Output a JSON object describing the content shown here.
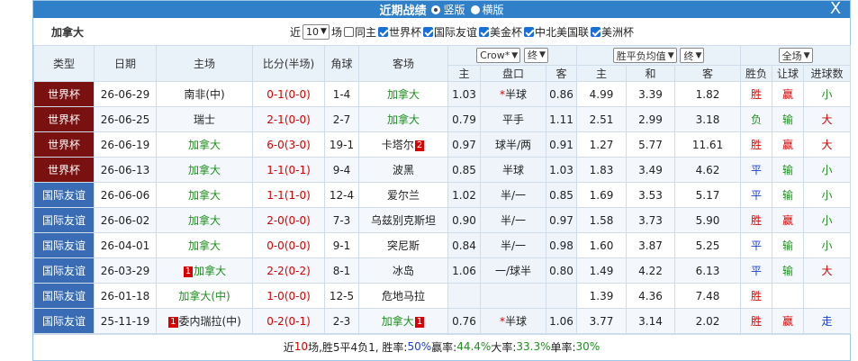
{
  "title": {
    "text": "近期战绩",
    "opt_vertical": "竖版",
    "opt_horizontal": "横版",
    "close": "X"
  },
  "filter": {
    "team": "加拿大",
    "prefix": "近",
    "count": "10",
    "suffix": "场",
    "same_host": "同主",
    "c1": "世界杯",
    "c2": "国际友谊",
    "c3": "美金杯",
    "c4": "中北美国联",
    "c5": "美洲杯"
  },
  "headers": {
    "type": "类型",
    "date": "日期",
    "home": "主场",
    "score": "比分(半场)",
    "corner": "角球",
    "away": "客场",
    "book": "Crow*",
    "book_end": "终",
    "home_o": "主",
    "handicap": "盘口",
    "away_o": "客",
    "avg": "胜平负均值",
    "avg_end": "终",
    "h": "主",
    "d": "和",
    "a": "客",
    "wl": "胜负",
    "hc": "让球",
    "goals": "进球数",
    "all": "全场"
  },
  "rows": [
    {
      "type": "世界杯",
      "kind": "wc",
      "date": "26-06-29",
      "home": "南非(中)",
      "home_green": false,
      "home_badge": "",
      "score": "0-1(0-0)",
      "corner": "1-4",
      "away": "加拿大",
      "away_green": true,
      "away_badge": "",
      "o1": "1.03",
      "hcap": "*半球",
      "o2": "0.86",
      "h": "4.99",
      "d": "3.39",
      "a": "1.82",
      "wl": "胜",
      "wl_c": "red",
      "hc": "赢",
      "hc_c": "red",
      "g": "小",
      "g_c": "green"
    },
    {
      "type": "世界杯",
      "kind": "wc",
      "date": "26-06-25",
      "home": "瑞士",
      "home_green": false,
      "home_badge": "",
      "score": "2-1(0-0)",
      "corner": "2-7",
      "away": "加拿大",
      "away_green": true,
      "away_badge": "",
      "o1": "0.79",
      "hcap": "平手",
      "o2": "1.11",
      "h": "2.51",
      "d": "2.99",
      "a": "3.18",
      "wl": "负",
      "wl_c": "green",
      "hc": "输",
      "hc_c": "green",
      "g": "大",
      "g_c": "red"
    },
    {
      "type": "世界杯",
      "kind": "wc",
      "date": "26-06-19",
      "home": "加拿大",
      "home_green": true,
      "home_badge": "",
      "score": "6-0(3-0)",
      "corner": "19-1",
      "away": "卡塔尔",
      "away_green": false,
      "away_badge": "2",
      "o1": "0.97",
      "hcap": "球半/两",
      "o2": "0.91",
      "h": "1.27",
      "d": "5.77",
      "a": "11.61",
      "wl": "胜",
      "wl_c": "red",
      "hc": "赢",
      "hc_c": "red",
      "g": "大",
      "g_c": "red"
    },
    {
      "type": "世界杯",
      "kind": "wc",
      "date": "26-06-13",
      "home": "加拿大",
      "home_green": true,
      "home_badge": "",
      "score": "1-1(0-1)",
      "corner": "9-4",
      "away": "波黑",
      "away_green": false,
      "away_badge": "",
      "o1": "0.85",
      "hcap": "半球",
      "o2": "1.03",
      "h": "1.83",
      "d": "3.49",
      "a": "4.62",
      "wl": "平",
      "wl_c": "blue",
      "hc": "输",
      "hc_c": "green",
      "g": "小",
      "g_c": "green"
    },
    {
      "type": "国际友谊",
      "kind": "fr",
      "date": "26-06-06",
      "home": "加拿大",
      "home_green": true,
      "home_badge": "",
      "score": "1-1(1-0)",
      "corner": "12-4",
      "away": "爱尔兰",
      "away_green": false,
      "away_badge": "",
      "o1": "1.02",
      "hcap": "半/一",
      "o2": "0.85",
      "h": "1.69",
      "d": "3.53",
      "a": "5.17",
      "wl": "平",
      "wl_c": "blue",
      "hc": "输",
      "hc_c": "green",
      "g": "小",
      "g_c": "green"
    },
    {
      "type": "国际友谊",
      "kind": "fr",
      "date": "26-06-02",
      "home": "加拿大",
      "home_green": true,
      "home_badge": "",
      "score": "2-0(0-0)",
      "corner": "7-3",
      "away": "乌兹别克斯坦",
      "away_green": false,
      "away_badge": "",
      "o1": "0.90",
      "hcap": "半/一",
      "o2": "0.97",
      "h": "1.58",
      "d": "3.73",
      "a": "5.90",
      "wl": "胜",
      "wl_c": "red",
      "hc": "赢",
      "hc_c": "red",
      "g": "小",
      "g_c": "green"
    },
    {
      "type": "国际友谊",
      "kind": "fr",
      "date": "26-04-01",
      "home": "加拿大",
      "home_green": true,
      "home_badge": "",
      "score": "0-0(0-0)",
      "corner": "9-1",
      "away": "突尼斯",
      "away_green": false,
      "away_badge": "",
      "o1": "0.84",
      "hcap": "半/一",
      "o2": "0.98",
      "h": "1.60",
      "d": "3.87",
      "a": "5.25",
      "wl": "平",
      "wl_c": "blue",
      "hc": "输",
      "hc_c": "green",
      "g": "小",
      "g_c": "green"
    },
    {
      "type": "国际友谊",
      "kind": "fr",
      "date": "26-03-29",
      "home": "加拿大",
      "home_green": true,
      "home_badge": "1",
      "score": "2-2(0-2)",
      "corner": "8-1",
      "away": "冰岛",
      "away_green": false,
      "away_badge": "",
      "o1": "1.06",
      "hcap": "一/球半",
      "o2": "0.80",
      "h": "1.49",
      "d": "4.22",
      "a": "6.13",
      "wl": "平",
      "wl_c": "blue",
      "hc": "输",
      "hc_c": "green",
      "g": "大",
      "g_c": "red"
    },
    {
      "type": "国际友谊",
      "kind": "fr",
      "date": "26-01-18",
      "home": "加拿大(中)",
      "home_green": true,
      "home_badge": "",
      "score": "1-0(0-0)",
      "corner": "12-5",
      "away": "危地马拉",
      "away_green": false,
      "away_badge": "",
      "o1": "",
      "hcap": "",
      "o2": "",
      "h": "1.39",
      "d": "4.36",
      "a": "7.48",
      "wl": "胜",
      "wl_c": "red",
      "hc": "",
      "hc_c": "red",
      "g": "",
      "g_c": "green"
    },
    {
      "type": "国际友谊",
      "kind": "fr",
      "date": "25-11-19",
      "home": "委内瑞拉(中)",
      "home_green": false,
      "home_badge": "1",
      "score": "0-2(0-1)",
      "corner": "2-3",
      "away": "加拿大",
      "away_green": true,
      "away_badge": "1",
      "o1": "0.76",
      "hcap": "*半球",
      "o2": "1.06",
      "h": "3.77",
      "d": "3.14",
      "a": "2.02",
      "wl": "胜",
      "wl_c": "red",
      "hc": "赢",
      "hc_c": "red",
      "g": "走",
      "g_c": "blue"
    }
  ],
  "summary": {
    "p1": "近",
    "n": "10",
    "p2": "场,胜5平4负1, 胜率:",
    "win": "50%",
    "p3": " 赢率:",
    "ying": "44.4%",
    "p4": " 大率:",
    "big": "33.3%",
    "p5": " 单率:",
    "odd": "30%"
  }
}
